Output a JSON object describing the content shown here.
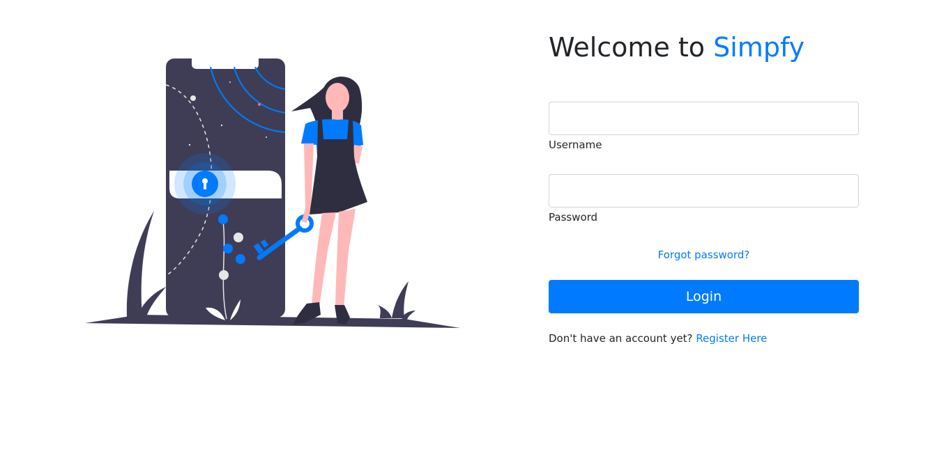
{
  "colors": {
    "brand": "#007bff",
    "text": "#212529",
    "input_border": "#ced4da",
    "illustration_dark": "#3f3d56",
    "illustration_skin": "#ffb8b8",
    "illustration_hair": "#2f2e41"
  },
  "login": {
    "title_prefix": "Welcome to",
    "title_brand": "Simpfy",
    "username": {
      "label": "Username",
      "value": "",
      "placeholder": ""
    },
    "password": {
      "label": "Password",
      "value": "",
      "placeholder": ""
    },
    "forgot_password_link": "Forgot password?",
    "login_button": "Login",
    "register_prompt": "Don't have an account yet?",
    "register_link": "Register Here"
  },
  "illustration": {
    "icons": [
      "phone-door-icon",
      "lock-icon",
      "key-icon",
      "woman-figure-icon",
      "plant-icon"
    ]
  }
}
